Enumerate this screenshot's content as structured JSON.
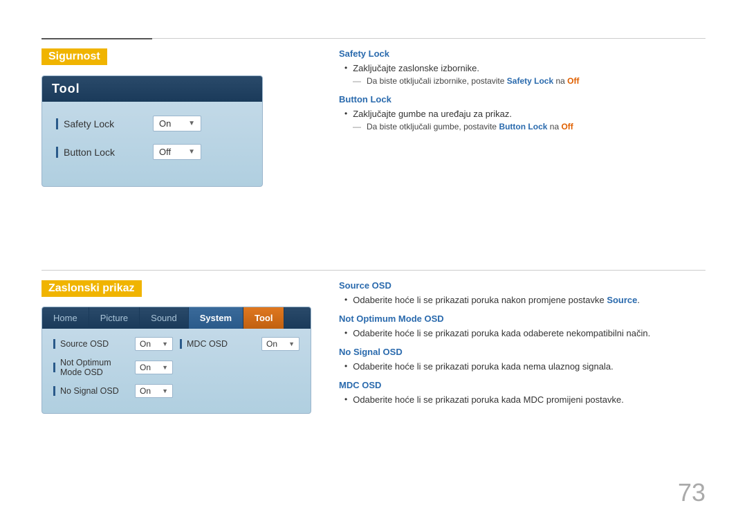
{
  "page": {
    "number": "73"
  },
  "sigurnost": {
    "title": "Sigurnost",
    "tool_panel": {
      "header": "Tool",
      "rows": [
        {
          "label": "Safety Lock",
          "value": "On"
        },
        {
          "label": "Button Lock",
          "value": "Off"
        }
      ]
    },
    "descriptions": [
      {
        "heading": "Safety Lock",
        "bullets": [
          {
            "text": "Zaključajte zaslonske izbornike."
          }
        ],
        "sub": "Da biste otključali izbornike, postavite Safety Lock na Off"
      },
      {
        "heading": "Button Lock",
        "bullets": [
          {
            "text": "Zaključajte gumbe na uređaju za prikaz."
          }
        ],
        "sub": "Da biste otključali gumbe, postavite Button Lock na Off"
      }
    ]
  },
  "zaslonski": {
    "title": "Zaslonski prikaz",
    "osd_panel": {
      "tabs": [
        {
          "label": "Home",
          "active": false
        },
        {
          "label": "Picture",
          "active": false
        },
        {
          "label": "Sound",
          "active": false
        },
        {
          "label": "System",
          "active": true
        },
        {
          "label": "Tool",
          "active": false,
          "highlight": false
        }
      ],
      "rows_left": [
        {
          "label": "Source OSD",
          "value": "On"
        },
        {
          "label": "Not Optimum Mode OSD",
          "value": "On"
        },
        {
          "label": "No Signal OSD",
          "value": "On"
        }
      ],
      "rows_right": [
        {
          "label": "MDC OSD",
          "value": "On"
        }
      ]
    },
    "descriptions": [
      {
        "heading": "Source OSD",
        "bullet": "Odaberite hoće li se prikazati poruka nakon promjene postavke Source."
      },
      {
        "heading": "Not Optimum Mode OSD",
        "bullet": "Odaberite hoće li se prikazati poruka kada odaberete nekompatibilni način."
      },
      {
        "heading": "No Signal OSD",
        "bullet": "Odaberite hoće li se prikazati poruka kada nema ulaznog signala."
      },
      {
        "heading": "MDC OSD",
        "bullet": "Odaberite hoće li se prikazati poruka kada MDC promijeni postavke."
      }
    ]
  }
}
